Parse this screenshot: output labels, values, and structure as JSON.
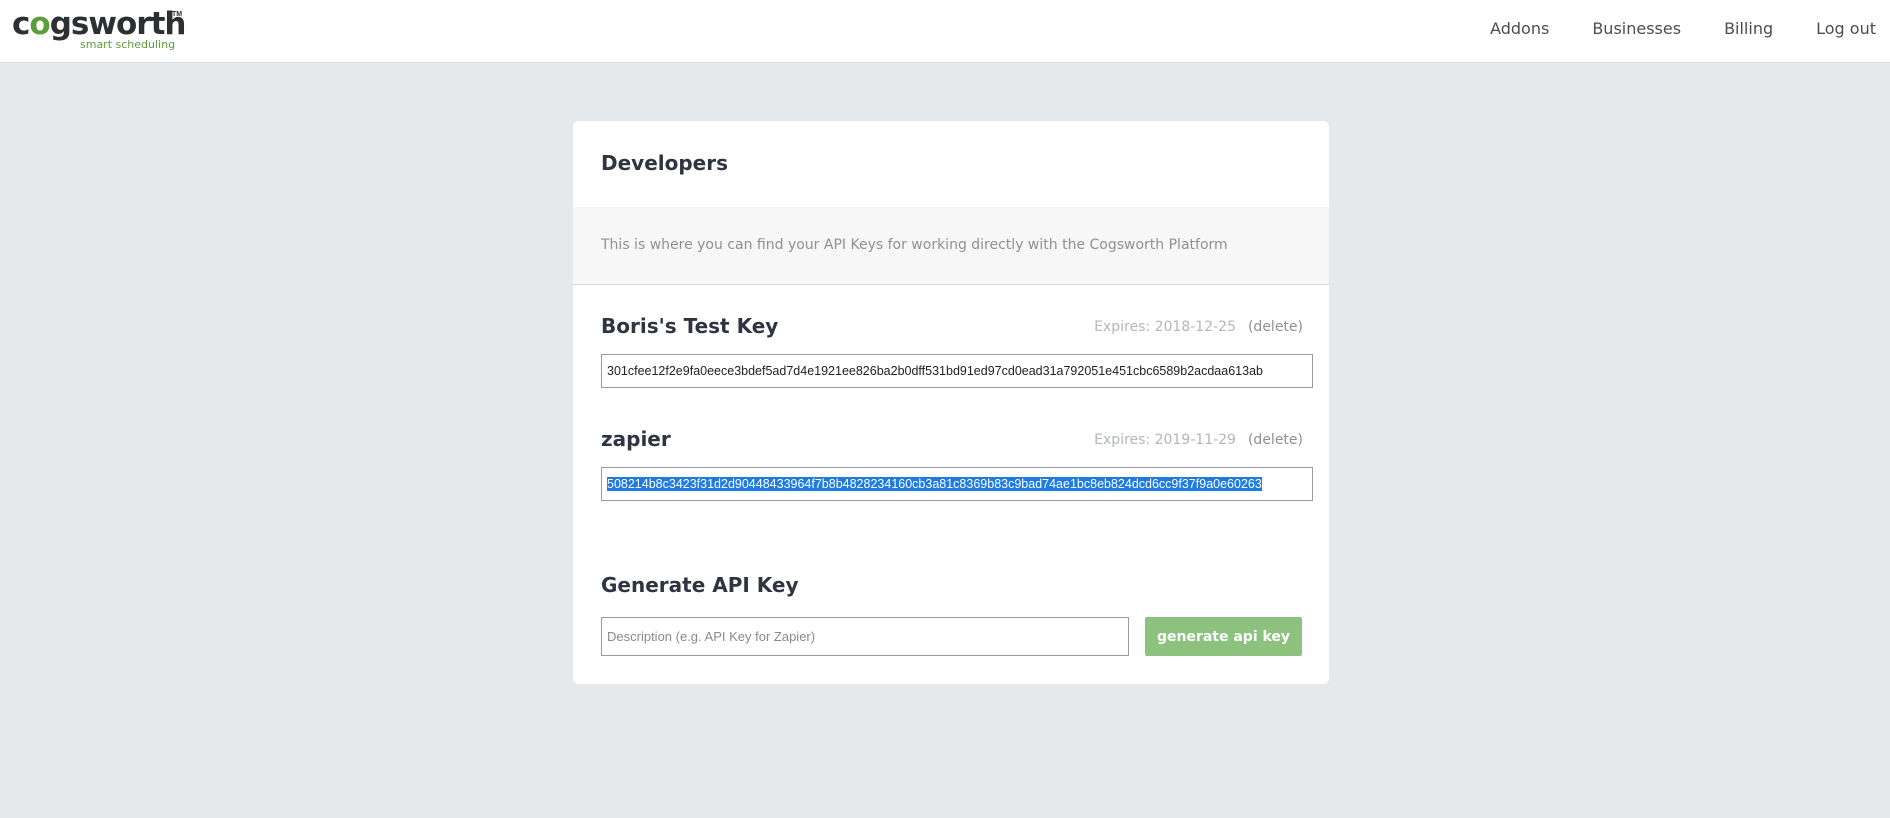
{
  "brand": {
    "logo_prefix": "c",
    "logo_gear": "o",
    "logo_suffix": "gsworth",
    "logo_tm": "TM",
    "tagline": "smart scheduling",
    "accent_color": "#5b9e3c"
  },
  "nav": {
    "items": [
      {
        "label": "Addons"
      },
      {
        "label": "Businesses"
      },
      {
        "label": "Billing"
      },
      {
        "label": "Log out"
      }
    ]
  },
  "developers": {
    "title": "Developers",
    "description": "This is where you can find your API Keys for working directly with the Cogsworth Platform",
    "keys": [
      {
        "name": "Boris's Test Key",
        "expires": "Expires: 2018-12-25",
        "delete_label": "(delete)",
        "value": "301cfee12f2e9fa0eece3bdef5ad7d4e1921ee826ba2b0dff531bd91ed97cd0ead31a792051e451cbc6589b2acdaa613ab",
        "selected": false
      },
      {
        "name": "zapier",
        "expires": "Expires: 2019-11-29",
        "delete_label": "(delete)",
        "value": "508214b8c3423f31d2d90448433964f7b8b4828234160cb3a81c8369b83c9bad74ae1bc8eb824dcd6cc9f37f9a0e60263",
        "selected": true
      }
    ]
  },
  "generate": {
    "title": "Generate API Key",
    "placeholder": "Description (e.g. API Key for Zapier)",
    "button_label": "generate api key",
    "button_color": "#8cc17e"
  }
}
